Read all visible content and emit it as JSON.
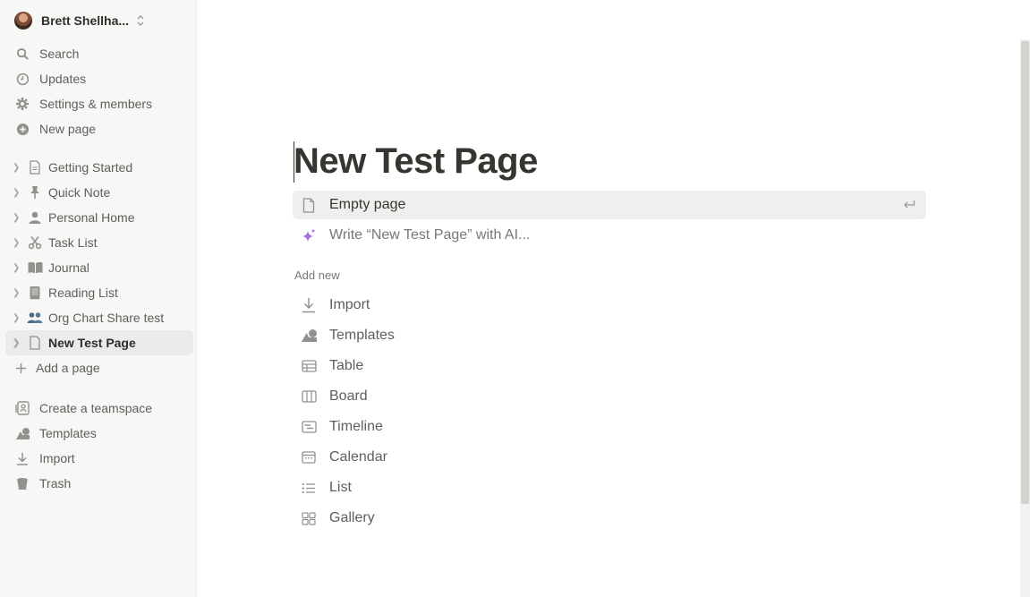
{
  "workspace": {
    "name": "Brett Shellha..."
  },
  "nav": {
    "search": "Search",
    "updates": "Updates",
    "settings": "Settings & members",
    "new_page": "New page"
  },
  "pages": [
    {
      "label": "Getting Started",
      "icon": "document-icon"
    },
    {
      "label": "Quick Note",
      "icon": "pin-icon"
    },
    {
      "label": "Personal Home",
      "icon": "person-icon"
    },
    {
      "label": "Task List",
      "icon": "scissors-icon"
    },
    {
      "label": "Journal",
      "icon": "book-icon"
    },
    {
      "label": "Reading List",
      "icon": "books-icon"
    },
    {
      "label": "Org Chart Share test",
      "icon": "people-icon"
    },
    {
      "label": "New Test Page",
      "icon": "document-icon"
    }
  ],
  "add_page": "Add a page",
  "bottom_nav": {
    "create_teamspace": "Create a teamspace",
    "templates": "Templates",
    "import": "Import",
    "trash": "Trash"
  },
  "page": {
    "title": "New Test Page",
    "empty_page": "Empty page",
    "ai_write": "Write “New Test Page” with AI...",
    "add_new_label": "Add new",
    "add_new": [
      "Import",
      "Templates",
      "Table",
      "Board",
      "Timeline",
      "Calendar",
      "List",
      "Gallery"
    ]
  },
  "colors": {
    "sidebar_bg": "#f7f7f5",
    "active_bg": "#ebebea",
    "ai_accent": "#a36ee0"
  }
}
